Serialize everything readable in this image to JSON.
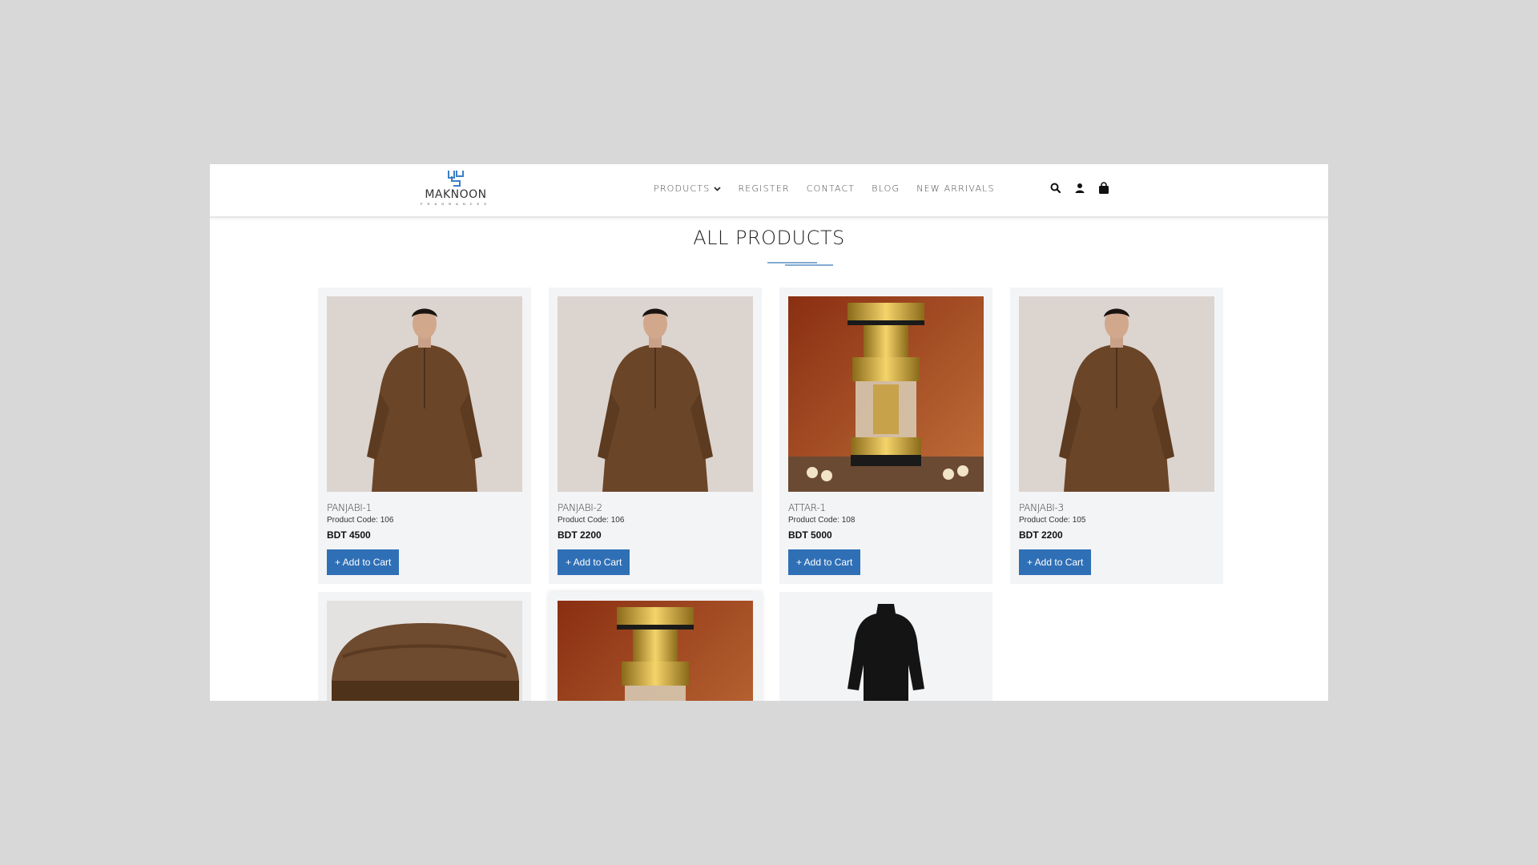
{
  "brand": {
    "name": "MAKNOON",
    "tagline": "FRAGRANCES"
  },
  "nav": {
    "products": "PRODUCTS",
    "register": "REGISTER",
    "contact": "CONTACT",
    "blog": "BLOG",
    "new_arrivals": "NEW ARRIVALS"
  },
  "icons": [
    "search-icon",
    "user-icon",
    "shopping-bag-icon"
  ],
  "page_title": "ALL PRODUCTS",
  "colors": {
    "accent": "#2f6fb6",
    "card_bg": "#f3f4f6",
    "background": "#d8d8d8"
  },
  "products": [
    {
      "name": "PANJABI-1",
      "code": "Product Code: 106",
      "price": "BDT 4500",
      "button": "+ Add to Cart",
      "image": "brown-panjabi-model"
    },
    {
      "name": "PANJABI-2",
      "code": "Product Code: 106",
      "price": "BDT 2200",
      "button": "+ Add to Cart",
      "image": "brown-panjabi-model"
    },
    {
      "name": "ATTAR-1",
      "code": "Product Code: 108",
      "price": "BDT 5000",
      "button": "+ Add to Cart",
      "image": "attar-bottle"
    },
    {
      "name": "PANJABI-3",
      "code": "Product Code: 105",
      "price": "BDT 2200",
      "button": "+ Add to Cart",
      "image": "brown-panjabi-model"
    },
    {
      "image": "brown-cap"
    },
    {
      "image": "attar-bottle"
    },
    {
      "image": "black-panjabi"
    }
  ]
}
